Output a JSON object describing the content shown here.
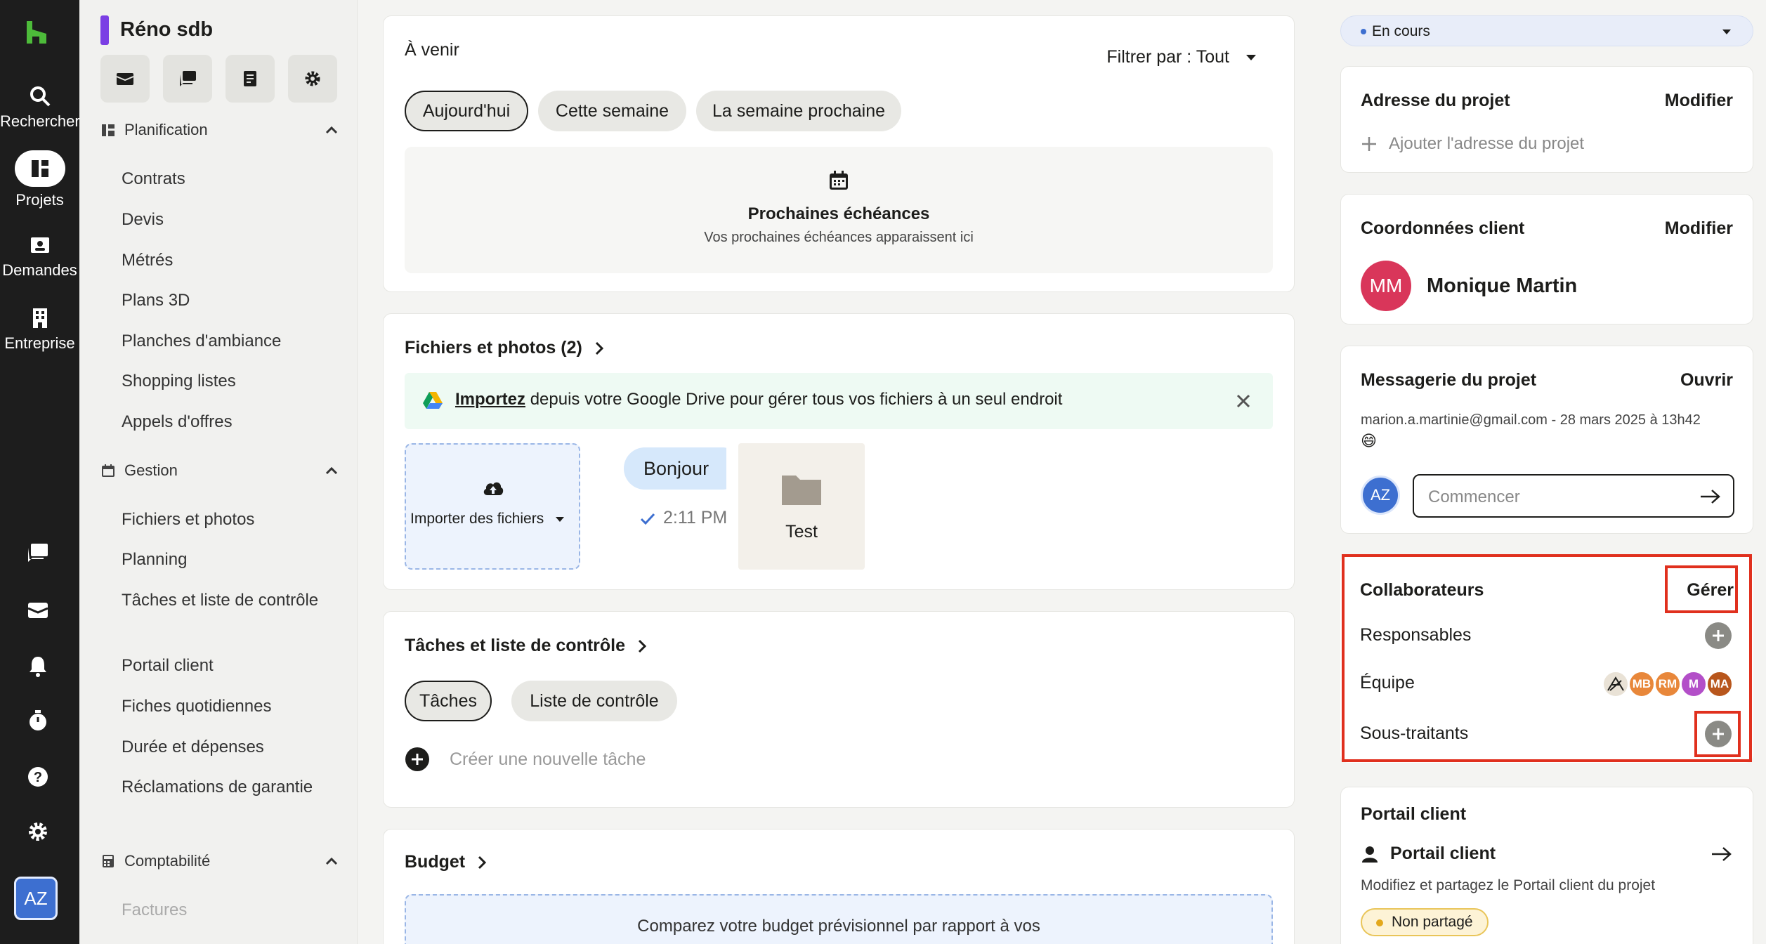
{
  "rail": {
    "search": "Rechercher",
    "projects": "Projets",
    "requests": "Demandes",
    "company": "Entreprise",
    "avatar": "AZ"
  },
  "sidebar": {
    "project_title": "Réno sdb",
    "planning": {
      "title": "Planification",
      "items": [
        "Contrats",
        "Devis",
        "Métrés",
        "Plans 3D",
        "Planches d'ambiance",
        "Shopping listes",
        "Appels d'offres"
      ]
    },
    "management": {
      "title": "Gestion",
      "items": [
        "Fichiers et photos",
        "Planning",
        "Tâches et liste de contrôle",
        "Portail client",
        "Fiches quotidiennes",
        "Durée et dépenses",
        "Réclamations de garantie"
      ]
    },
    "accounting": {
      "title": "Comptabilité",
      "items": [
        "Factures"
      ]
    }
  },
  "upcoming": {
    "title": "À venir",
    "filter": "Filtrer par : Tout",
    "chips": [
      "Aujourd'hui",
      "Cette semaine",
      "La semaine prochaine"
    ],
    "empty_title": "Prochaines échéances",
    "empty_sub": "Vos prochaines échéances apparaissent ici"
  },
  "files": {
    "title": "Fichiers et photos (2)",
    "banner_link": "Importez",
    "banner_text": "depuis votre Google Drive pour gérer tous vos fichiers à un seul endroit",
    "upload_label": "Importer des fichiers",
    "bubble_text": "Bonjour",
    "bubble_time": "2:11 PM",
    "folder_name": "Test"
  },
  "tasks": {
    "title": "Tâches et liste de contrôle",
    "chips": [
      "Tâches",
      "Liste de contrôle"
    ],
    "new_task": "Créer une nouvelle tâche"
  },
  "budget": {
    "title": "Budget",
    "text": "Comparez votre budget prévisionnel par rapport à vos"
  },
  "right": {
    "status": "En cours",
    "address": {
      "title": "Adresse du projet",
      "action": "Modifier",
      "add": "Ajouter l'adresse du projet"
    },
    "client": {
      "title": "Coordonnées client",
      "action": "Modifier",
      "initials": "MM",
      "name": "Monique Martin"
    },
    "messaging": {
      "title": "Messagerie du projet",
      "action": "Ouvrir",
      "meta": "marion.a.martinie@gmail.com - 28 mars 2025 à 13h42",
      "emoji": "😄",
      "placeholder": "Commencer",
      "avatar": "AZ"
    },
    "collaborators": {
      "title": "Collaborateurs",
      "action": "Gérer",
      "rows": [
        "Responsables",
        "Équipe",
        "Sous-traitants"
      ],
      "team": [
        {
          "initials": "",
          "color": "#e9e2d6"
        },
        {
          "initials": "MB",
          "color": "#e8873a"
        },
        {
          "initials": "RM",
          "color": "#e8873a"
        },
        {
          "initials": "M",
          "color": "#b34fc8"
        },
        {
          "initials": "MA",
          "color": "#b8561c"
        }
      ]
    },
    "portal": {
      "title": "Portail client",
      "item": "Portail client",
      "desc": "Modifiez et partagez le Portail client du projet",
      "badge": "Non partagé"
    }
  },
  "colors": {
    "accent": "#7b3fe4",
    "highlight": "#e0301e",
    "client_avatar": "#d9365a"
  }
}
